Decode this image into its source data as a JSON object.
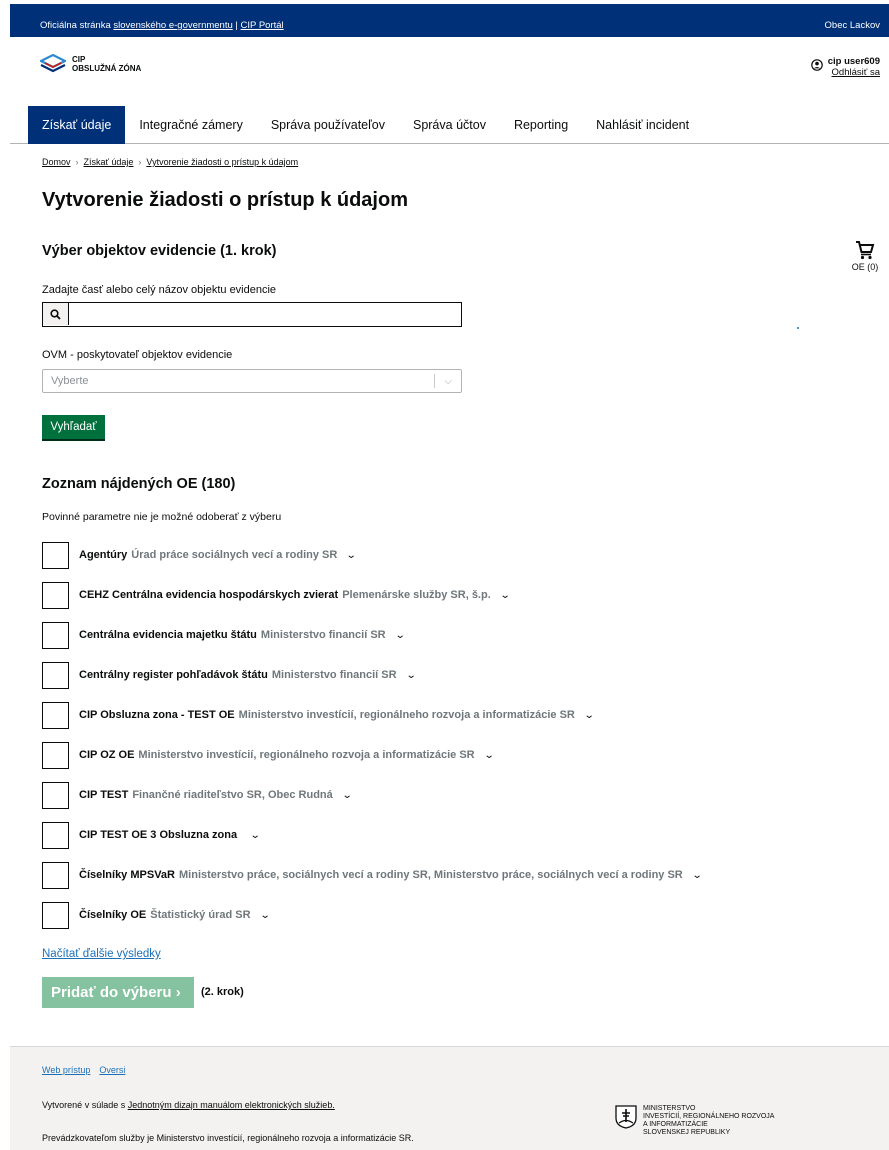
{
  "topbar": {
    "official_prefix": "Oficiálna stránka ",
    "egov_link": "slovenského e-governmentu",
    "divider": " | ",
    "cip_link": "CIP Portál",
    "org": "Obec Lackov"
  },
  "logo": {
    "line1": "CIP",
    "line2": "OBSLUŽNÁ ZÓNA"
  },
  "user": {
    "name": "cip user609",
    "logout": "Odhlásiť sa"
  },
  "nav": [
    "Získať údaje",
    "Integračné zámery",
    "Správa používateľov",
    "Správa účtov",
    "Reporting",
    "Nahlásiť incident"
  ],
  "breadcrumb": [
    "Domov",
    "Získať údaje",
    "Vytvorenie žiadosti o prístup k údajom"
  ],
  "page_title": "Vytvorenie žiadosti o prístup k údajom",
  "step1": {
    "heading": "Výber objektov evidencie (1. krok)",
    "search_label": "Zadajte časť alebo celý názov objektu evidencie",
    "search_value": "",
    "ovm_label": "OVM - poskytovateľ objektov evidencie",
    "ovm_placeholder": "Vyberte",
    "search_button": "Vyhľadať"
  },
  "cart": {
    "label": "OE (0)"
  },
  "results": {
    "heading": "Zoznam nájdených OE (180)",
    "hint": "Povinné parametre nie je možné odoberať z výberu",
    "items": [
      {
        "name": "Agentúry",
        "ovm": "Úrad práce sociálnych vecí a rodiny SR"
      },
      {
        "name": "CEHZ Centrálna evidencia hospodárskych zvierat",
        "ovm": "Plemenárske služby SR, š.p."
      },
      {
        "name": "Centrálna evidencia majetku štátu",
        "ovm": "Ministerstvo financií SR"
      },
      {
        "name": "Centrálny register pohľadávok štátu",
        "ovm": "Ministerstvo financií SR"
      },
      {
        "name": "CIP Obsluzna zona - TEST OE",
        "ovm": "Ministerstvo investícií, regionálneho rozvoja a informatizácie SR"
      },
      {
        "name": "CIP OZ OE",
        "ovm": "Ministerstvo investícií, regionálneho rozvoja a informatizácie SR"
      },
      {
        "name": "CIP TEST",
        "ovm": "Finančné riaditeľstvo SR, Obec Rudná"
      },
      {
        "name": "CIP TEST OE 3 Obsluzna zona",
        "ovm": ""
      },
      {
        "name": "Číselníky MPSVaR",
        "ovm": "Ministerstvo práce, sociálnych vecí a rodiny SR, Ministerstvo práce, sociálnych vecí a rodiny SR"
      },
      {
        "name": "Číselníky OE",
        "ovm": "Štatistický úrad SR"
      }
    ],
    "load_more": "Načítať ďalšie výsledky",
    "add_button": "Pridať do výberu",
    "step2": "(2. krok)"
  },
  "footer": {
    "links": [
      "Web prístup",
      "Oversi"
    ],
    "line1_prefix": "Vytvorené v súlade s ",
    "line1_link": "Jednotným dizajn manuálom elektronických služieb.",
    "line2": "Prevádzkovateľom služby je Ministerstvo investícií, regionálneho rozvoja a informatizácie SR.",
    "ministry": [
      "Ministerstvo",
      "investícií, regionálneho rozvoja",
      "a informatizácie",
      "Slovenskej republiky"
    ]
  },
  "colors": {
    "primary": "#003078",
    "button_green": "#00703c",
    "button_disabled": "#85c2a0",
    "link": "#1d70b8"
  }
}
